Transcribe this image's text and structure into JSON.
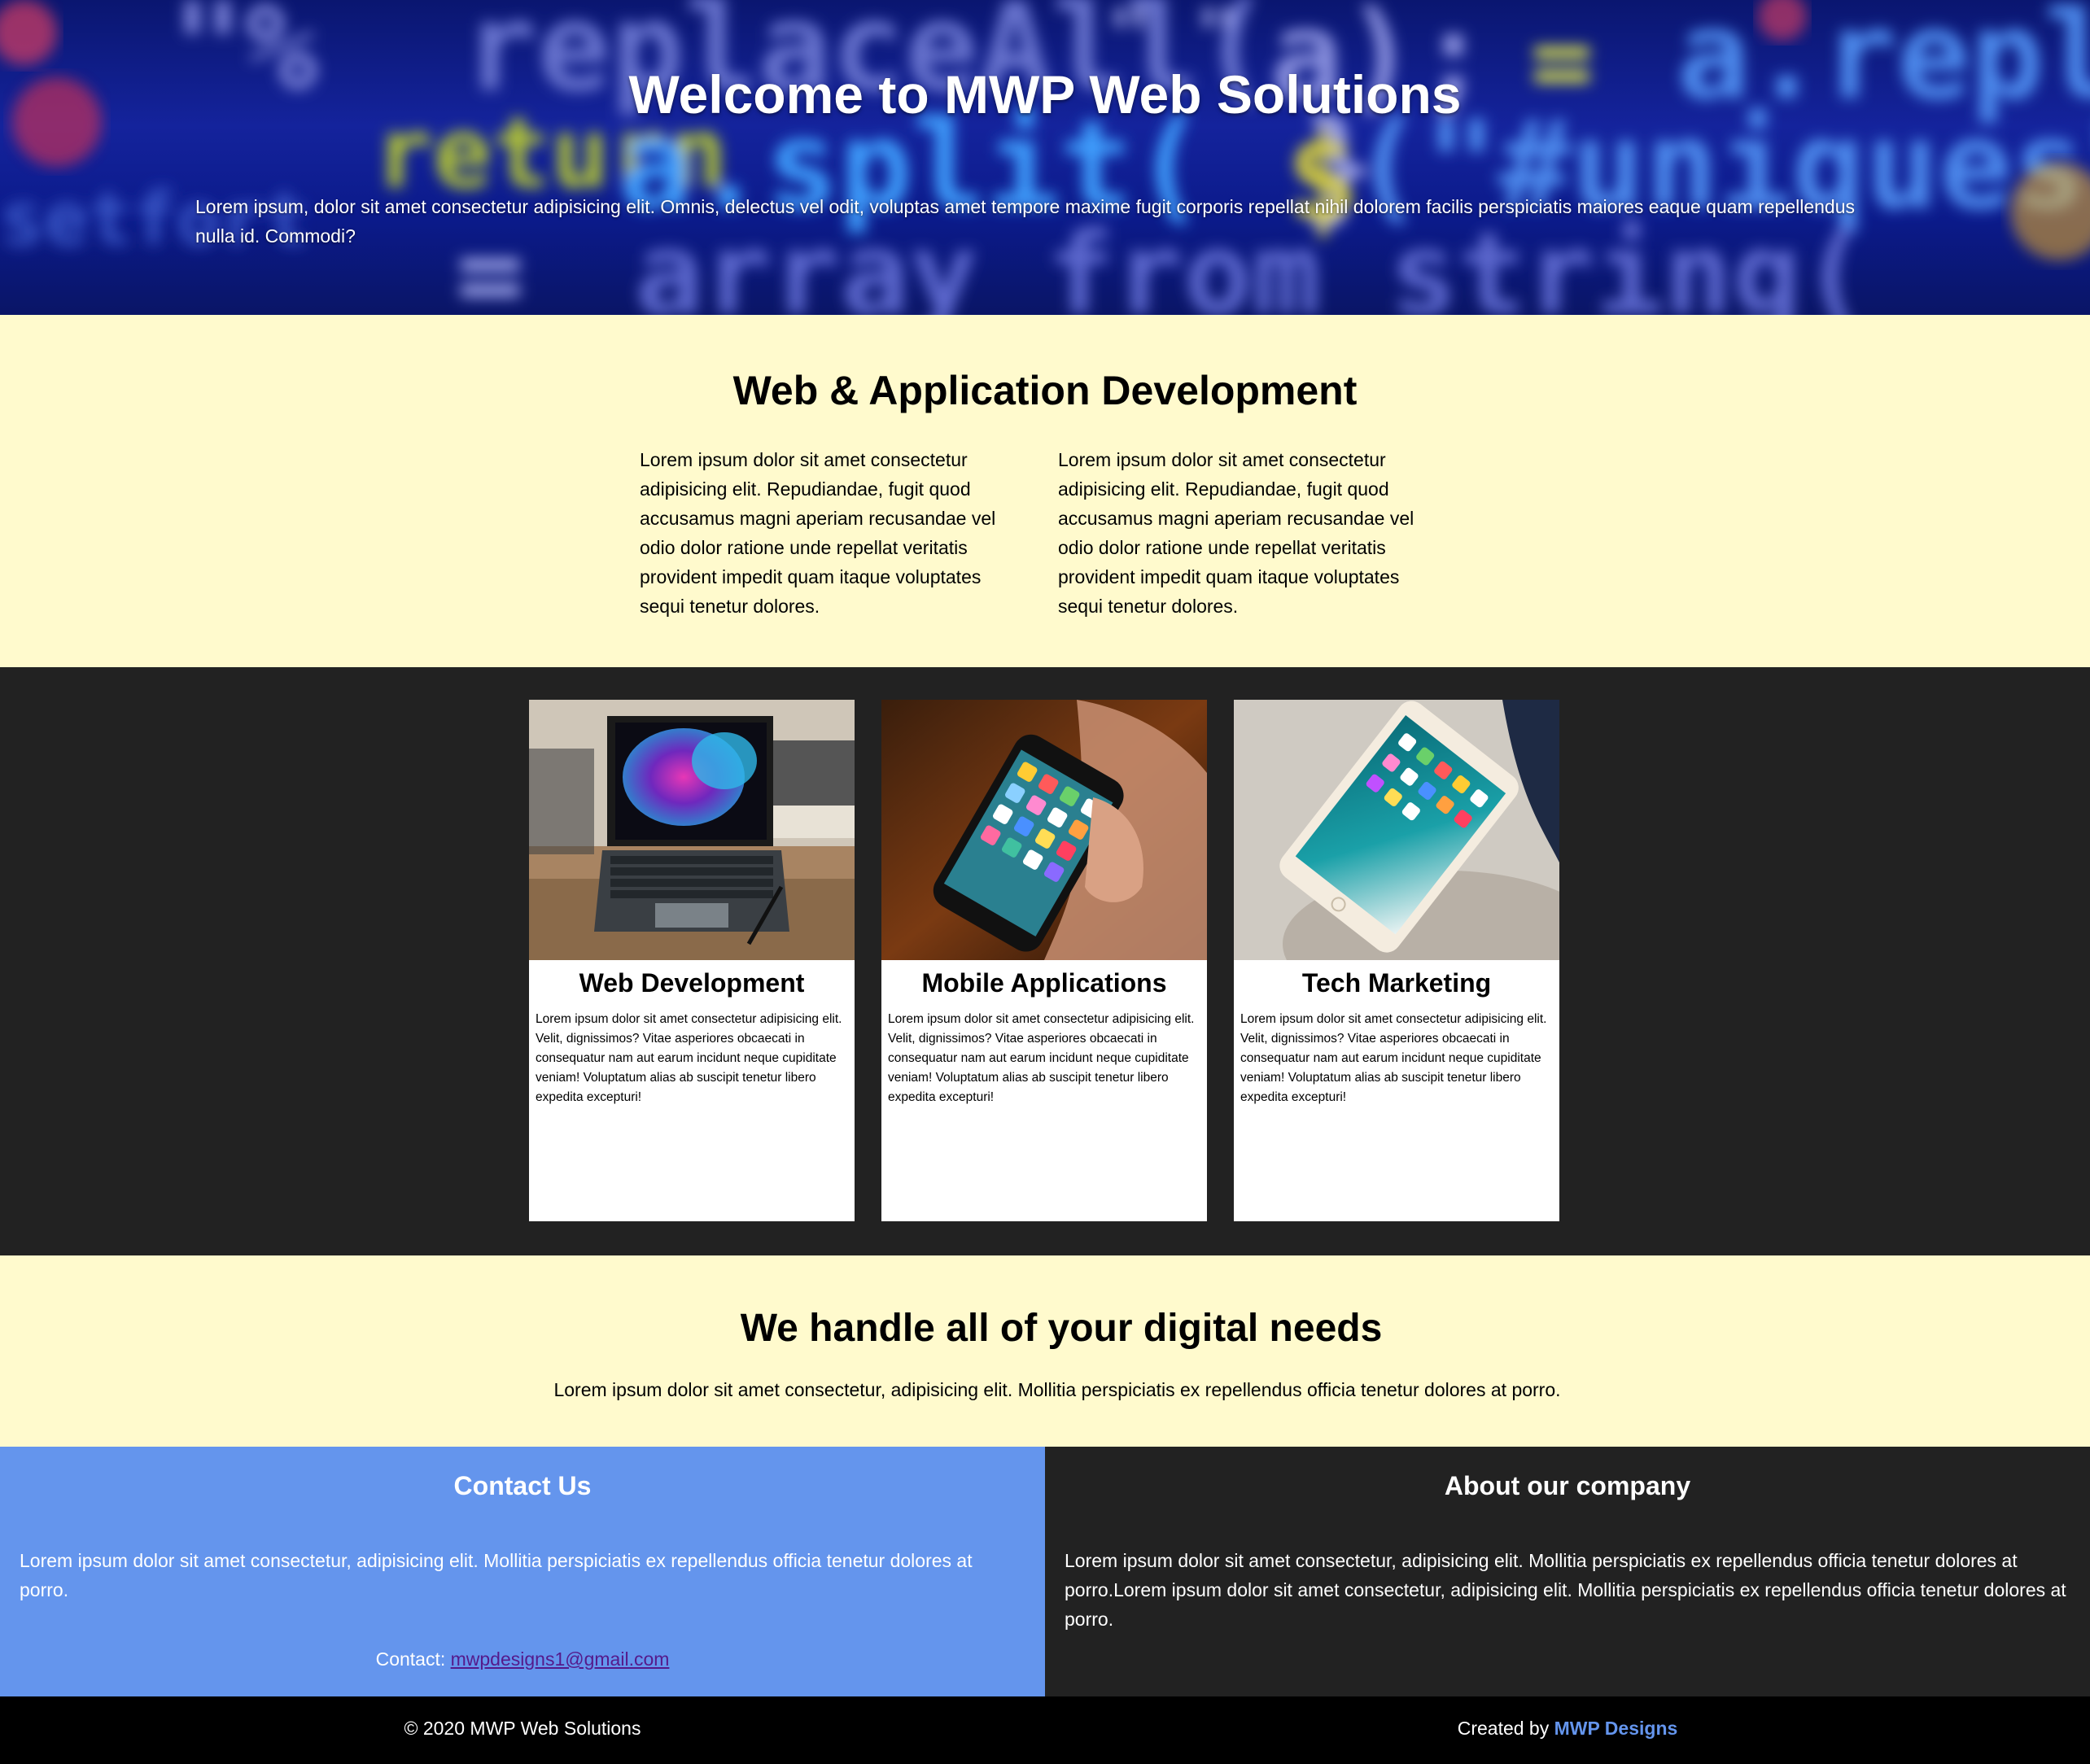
{
  "hero": {
    "title": "Welcome to MWP Web Solutions",
    "text": "Lorem ipsum, dolor sit amet consectetur adipisicing elit. Omnis, delectus vel odit, voluptas amet tempore maxime fugit corporis repellat nihil dolorem facilis perspiciatis maiores eaque quam repellendus nulla id. Commodi?"
  },
  "webapp": {
    "title": "Web & Application Development",
    "col_left": "Lorem ipsum dolor sit amet consectetur adipisicing elit. Repudiandae, fugit quod accusamus magni aperiam recusandae vel odio dolor ratione unde repellat veritatis provident impedit quam itaque voluptates sequi tenetur dolores.",
    "col_right": "Lorem ipsum dolor sit amet consectetur adipisicing elit. Repudiandae, fugit quod accusamus magni aperiam recusandae vel odio dolor ratione unde repellat veritatis provident impedit quam itaque voluptates sequi tenetur dolores."
  },
  "cards": [
    {
      "title": "Web Development",
      "text": "Lorem ipsum dolor sit amet consectetur adipisicing elit. Velit, dignissimos? Vitae asperiores obcaecati in consequatur nam aut earum incidunt neque cupiditate veniam! Voluptatum alias ab suscipit tenetur libero expedita excepturi!"
    },
    {
      "title": "Mobile Applications",
      "text": "Lorem ipsum dolor sit amet consectetur adipisicing elit. Velit, dignissimos? Vitae asperiores obcaecati in consequatur nam aut earum incidunt neque cupiditate veniam! Voluptatum alias ab suscipit tenetur libero expedita excepturi!"
    },
    {
      "title": "Tech Marketing",
      "text": "Lorem ipsum dolor sit amet consectetur adipisicing elit. Velit, dignissimos? Vitae asperiores obcaecati in consequatur nam aut earum incidunt neque cupiditate veniam! Voluptatum alias ab suscipit tenetur libero expedita excepturi!"
    }
  ],
  "digital": {
    "title": "We handle all of your digital needs",
    "text": "Lorem ipsum dolor sit amet consectetur, adipisicing elit. Mollitia perspiciatis ex repellendus officia tenetur dolores at porro."
  },
  "contact": {
    "title": "Contact Us",
    "text": "Lorem ipsum dolor sit amet consectetur, adipisicing elit. Mollitia perspiciatis ex repellendus officia tenetur dolores at porro.",
    "label": "Contact:",
    "email": "mwpdesigns1@gmail.com"
  },
  "about": {
    "title": "About our company",
    "text": "Lorem ipsum dolor sit amet consectetur, adipisicing elit. Mollitia perspiciatis ex repellendus officia tenetur dolores at porro.Lorem ipsum dolor sit amet consectetur, adipisicing elit. Mollitia perspiciatis ex repellendus officia tenetur dolores at porro."
  },
  "footer": {
    "copyright": "© 2020 MWP Web Solutions",
    "created_by": "Created by",
    "designer": "MWP Designs"
  },
  "colors": {
    "cream": "#fffacd",
    "dark": "#222222",
    "contact_blue": "#6495ed",
    "link_purple": "#551a8b"
  }
}
